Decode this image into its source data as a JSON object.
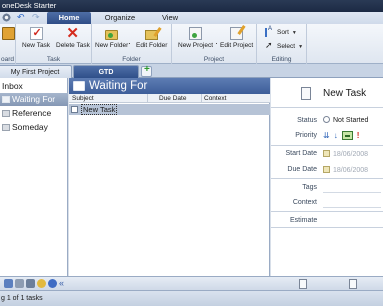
{
  "window": {
    "title": "oneDesk Starter"
  },
  "ribbon_tabs": [
    "Home",
    "Organize",
    "View"
  ],
  "ribbon": {
    "groups": {
      "clipboard": "oard",
      "task": "Task",
      "folder": "Folder",
      "project": "Project",
      "editing": "Editing"
    },
    "buttons": {
      "new_task": "New Task",
      "delete_task": "Delete Task",
      "new_folder": "New Folder",
      "edit_folder": "Edit Folder",
      "new_project": "New Project",
      "edit_project": "Edit Project",
      "sort": "Sort",
      "select": "Select"
    }
  },
  "project_tabs": [
    "My First Project",
    "GTD"
  ],
  "nav": [
    "Inbox",
    "Waiting For",
    "Reference",
    "Someday"
  ],
  "list": {
    "title": "Waiting For",
    "columns": [
      "Subject",
      "Due Date",
      "Context"
    ],
    "rows": [
      {
        "subject": "New Task"
      }
    ]
  },
  "detail": {
    "title": "New Task",
    "status_label": "Status",
    "status_value": "Not Started",
    "priority_label": "Priority",
    "start_label": "Start Date",
    "start_value": "18/06/2008",
    "due_label": "Due Date",
    "due_value": "18/06/2008",
    "tags_label": "Tags",
    "context_label": "Context",
    "estimate_label": "Estimate"
  },
  "statusbar": {
    "text": "g 1 of 1 tasks"
  },
  "colors": {
    "accent": "#3d5e99",
    "selection": "#b6c3d6",
    "high_priority": "#d22a1e"
  }
}
